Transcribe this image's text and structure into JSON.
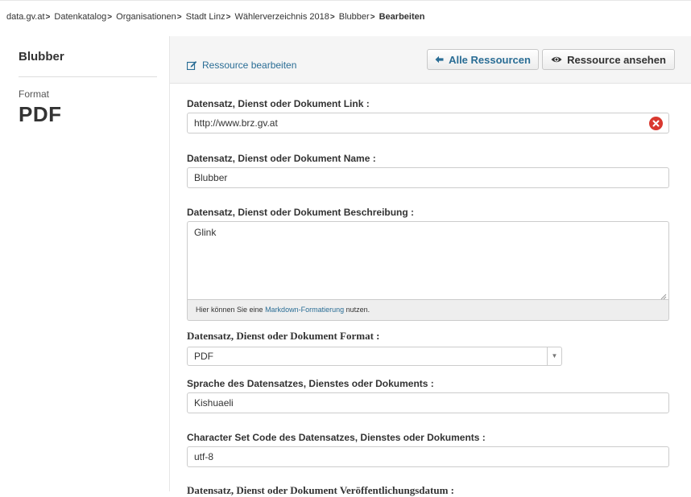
{
  "breadcrumb": {
    "items": [
      "data.gv.at",
      "Datenkatalog",
      "Organisationen",
      "Stadt Linz",
      "Wählerverzeichnis 2018",
      "Blubber"
    ],
    "current": "Bearbeiten",
    "separator": ">"
  },
  "sidebar": {
    "title": "Blubber",
    "format_label": "Format",
    "format_value": "PDF"
  },
  "actions": {
    "edit_link": "Ressource bearbeiten",
    "all_resources_button": "Alle Ressourcen",
    "view_resource_button": "Ressource ansehen"
  },
  "form": {
    "link": {
      "label": "Datensatz, Dienst oder Dokument Link :",
      "value": "http://www.brz.gv.at"
    },
    "name": {
      "label": "Datensatz, Dienst oder Dokument Name :",
      "value": "Blubber"
    },
    "description": {
      "label": "Datensatz, Dienst oder Dokument Beschreibung :",
      "value": "Glink",
      "hint_prefix": "Hier können Sie eine ",
      "hint_link": "Markdown-Formatierung",
      "hint_suffix": " nutzen."
    },
    "format": {
      "label": "Datensatz, Dienst oder Dokument Format :",
      "value": "PDF"
    },
    "language": {
      "label": "Sprache des Datensatzes, Dienstes oder Dokuments :",
      "value": "Kishuaeli"
    },
    "charset": {
      "label": "Character Set Code des Datensatzes, Dienstes oder Dokuments :",
      "value": "utf-8"
    },
    "publication_date": {
      "label": "Datensatz, Dienst oder Dokument Veröffentlichungsdatum :"
    }
  },
  "colors": {
    "link": "#2a6d95",
    "clear_button": "#d9382f",
    "panel_bg": "#f5f5f5"
  }
}
